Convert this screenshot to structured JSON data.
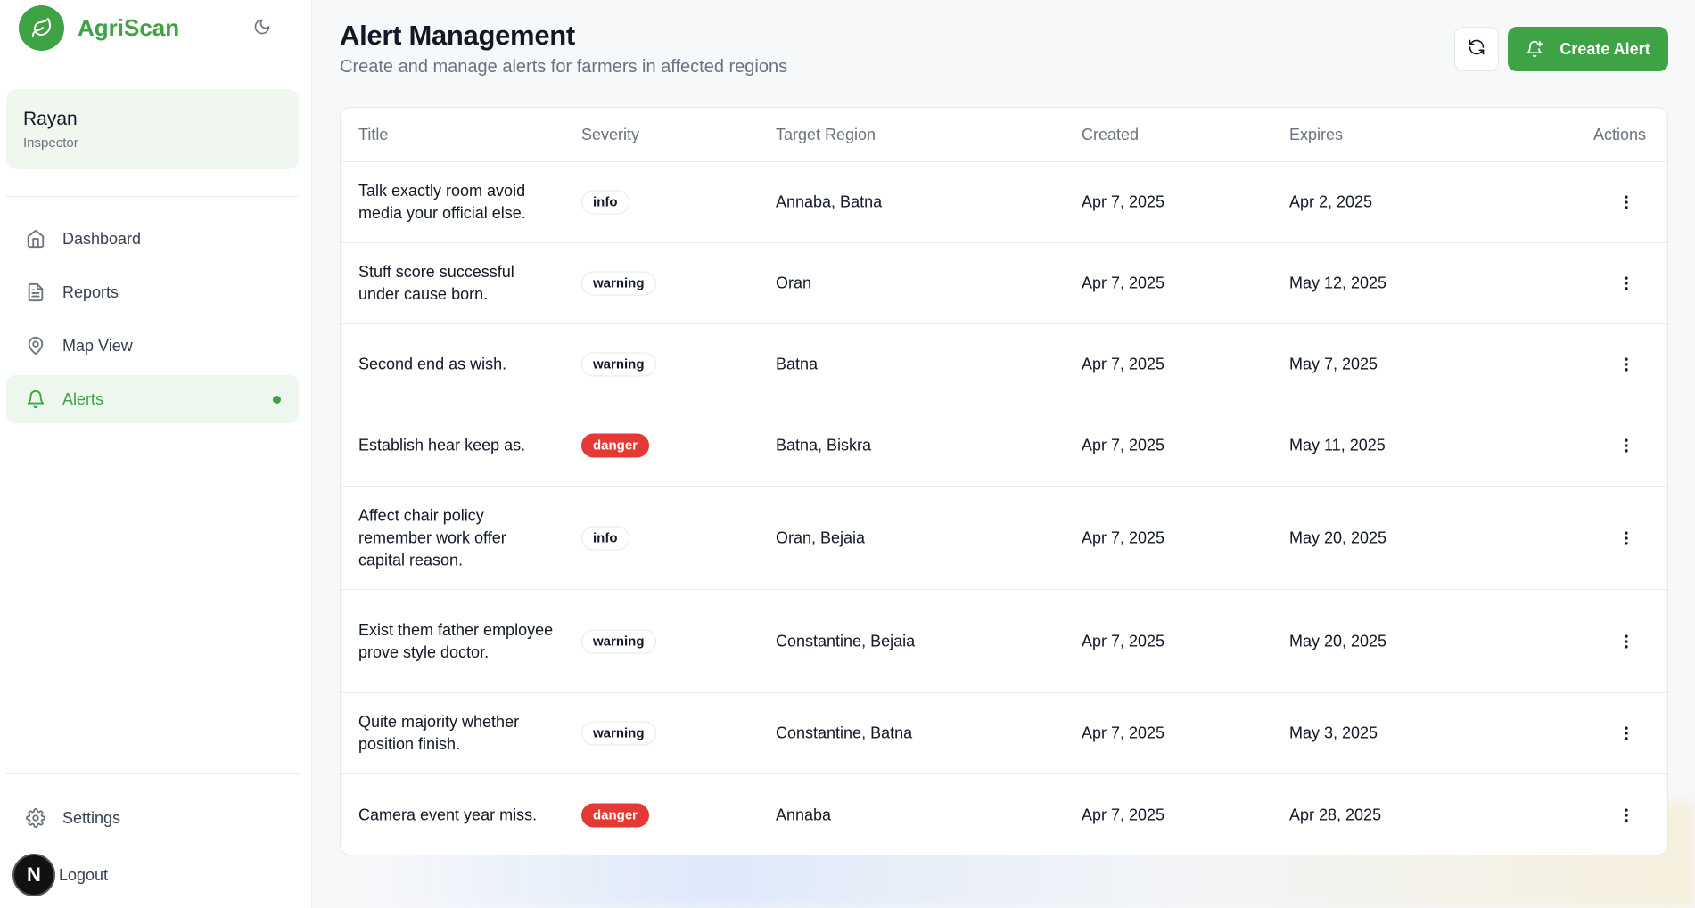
{
  "brand": {
    "name": "AgriScan",
    "color": "#3ea345"
  },
  "user": {
    "name": "Rayan",
    "role": "Inspector"
  },
  "nav": {
    "dashboard": "Dashboard",
    "reports": "Reports",
    "map_view": "Map View",
    "alerts": "Alerts",
    "settings": "Settings",
    "logout": "Logout"
  },
  "avatar_initial": "N",
  "page": {
    "title": "Alert Management",
    "subtitle": "Create and manage alerts for farmers in affected regions"
  },
  "toolbar": {
    "create_label": "Create Alert"
  },
  "table": {
    "headers": {
      "title": "Title",
      "severity": "Severity",
      "region": "Target Region",
      "created": "Created",
      "expires": "Expires",
      "actions": "Actions"
    },
    "rows": [
      {
        "title": "Talk exactly room avoid media your official else.",
        "severity": "info",
        "region": "Annaba, Batna",
        "created": "Apr 7, 2025",
        "expires": "Apr 2, 2025"
      },
      {
        "title": "Stuff score successful under cause born.",
        "severity": "warning",
        "region": "Oran",
        "created": "Apr 7, 2025",
        "expires": "May 12, 2025"
      },
      {
        "title": "Second end as wish.",
        "severity": "warning",
        "region": "Batna",
        "created": "Apr 7, 2025",
        "expires": "May 7, 2025"
      },
      {
        "title": "Establish hear keep as.",
        "severity": "danger",
        "region": "Batna, Biskra",
        "created": "Apr 7, 2025",
        "expires": "May 11, 2025"
      },
      {
        "title": "Affect chair policy remember work offer capital reason.",
        "severity": "info",
        "region": "Oran, Bejaia",
        "created": "Apr 7, 2025",
        "expires": "May 20, 2025"
      },
      {
        "title": "Exist them father employee prove style doctor.",
        "severity": "warning",
        "region": "Constantine, Bejaia",
        "created": "Apr 7, 2025",
        "expires": "May 20, 2025"
      },
      {
        "title": "Quite majority whether position finish.",
        "severity": "warning",
        "region": "Constantine, Batna",
        "created": "Apr 7, 2025",
        "expires": "May 3, 2025"
      },
      {
        "title": "Camera event year miss.",
        "severity": "danger",
        "region": "Annaba",
        "created": "Apr 7, 2025",
        "expires": "Apr 28, 2025"
      }
    ]
  },
  "colors": {
    "accent": "#3ea345",
    "danger": "#e53935"
  },
  "icons": {
    "brand": "leaf-icon",
    "theme": "moon-icon",
    "dashboard": "home-icon",
    "reports": "document-icon",
    "map_view": "map-pin-icon",
    "alerts": "bell-icon",
    "settings": "gear-icon",
    "refresh": "refresh-icon",
    "create": "bell-plus-icon",
    "row_actions": "kebab-icon"
  }
}
